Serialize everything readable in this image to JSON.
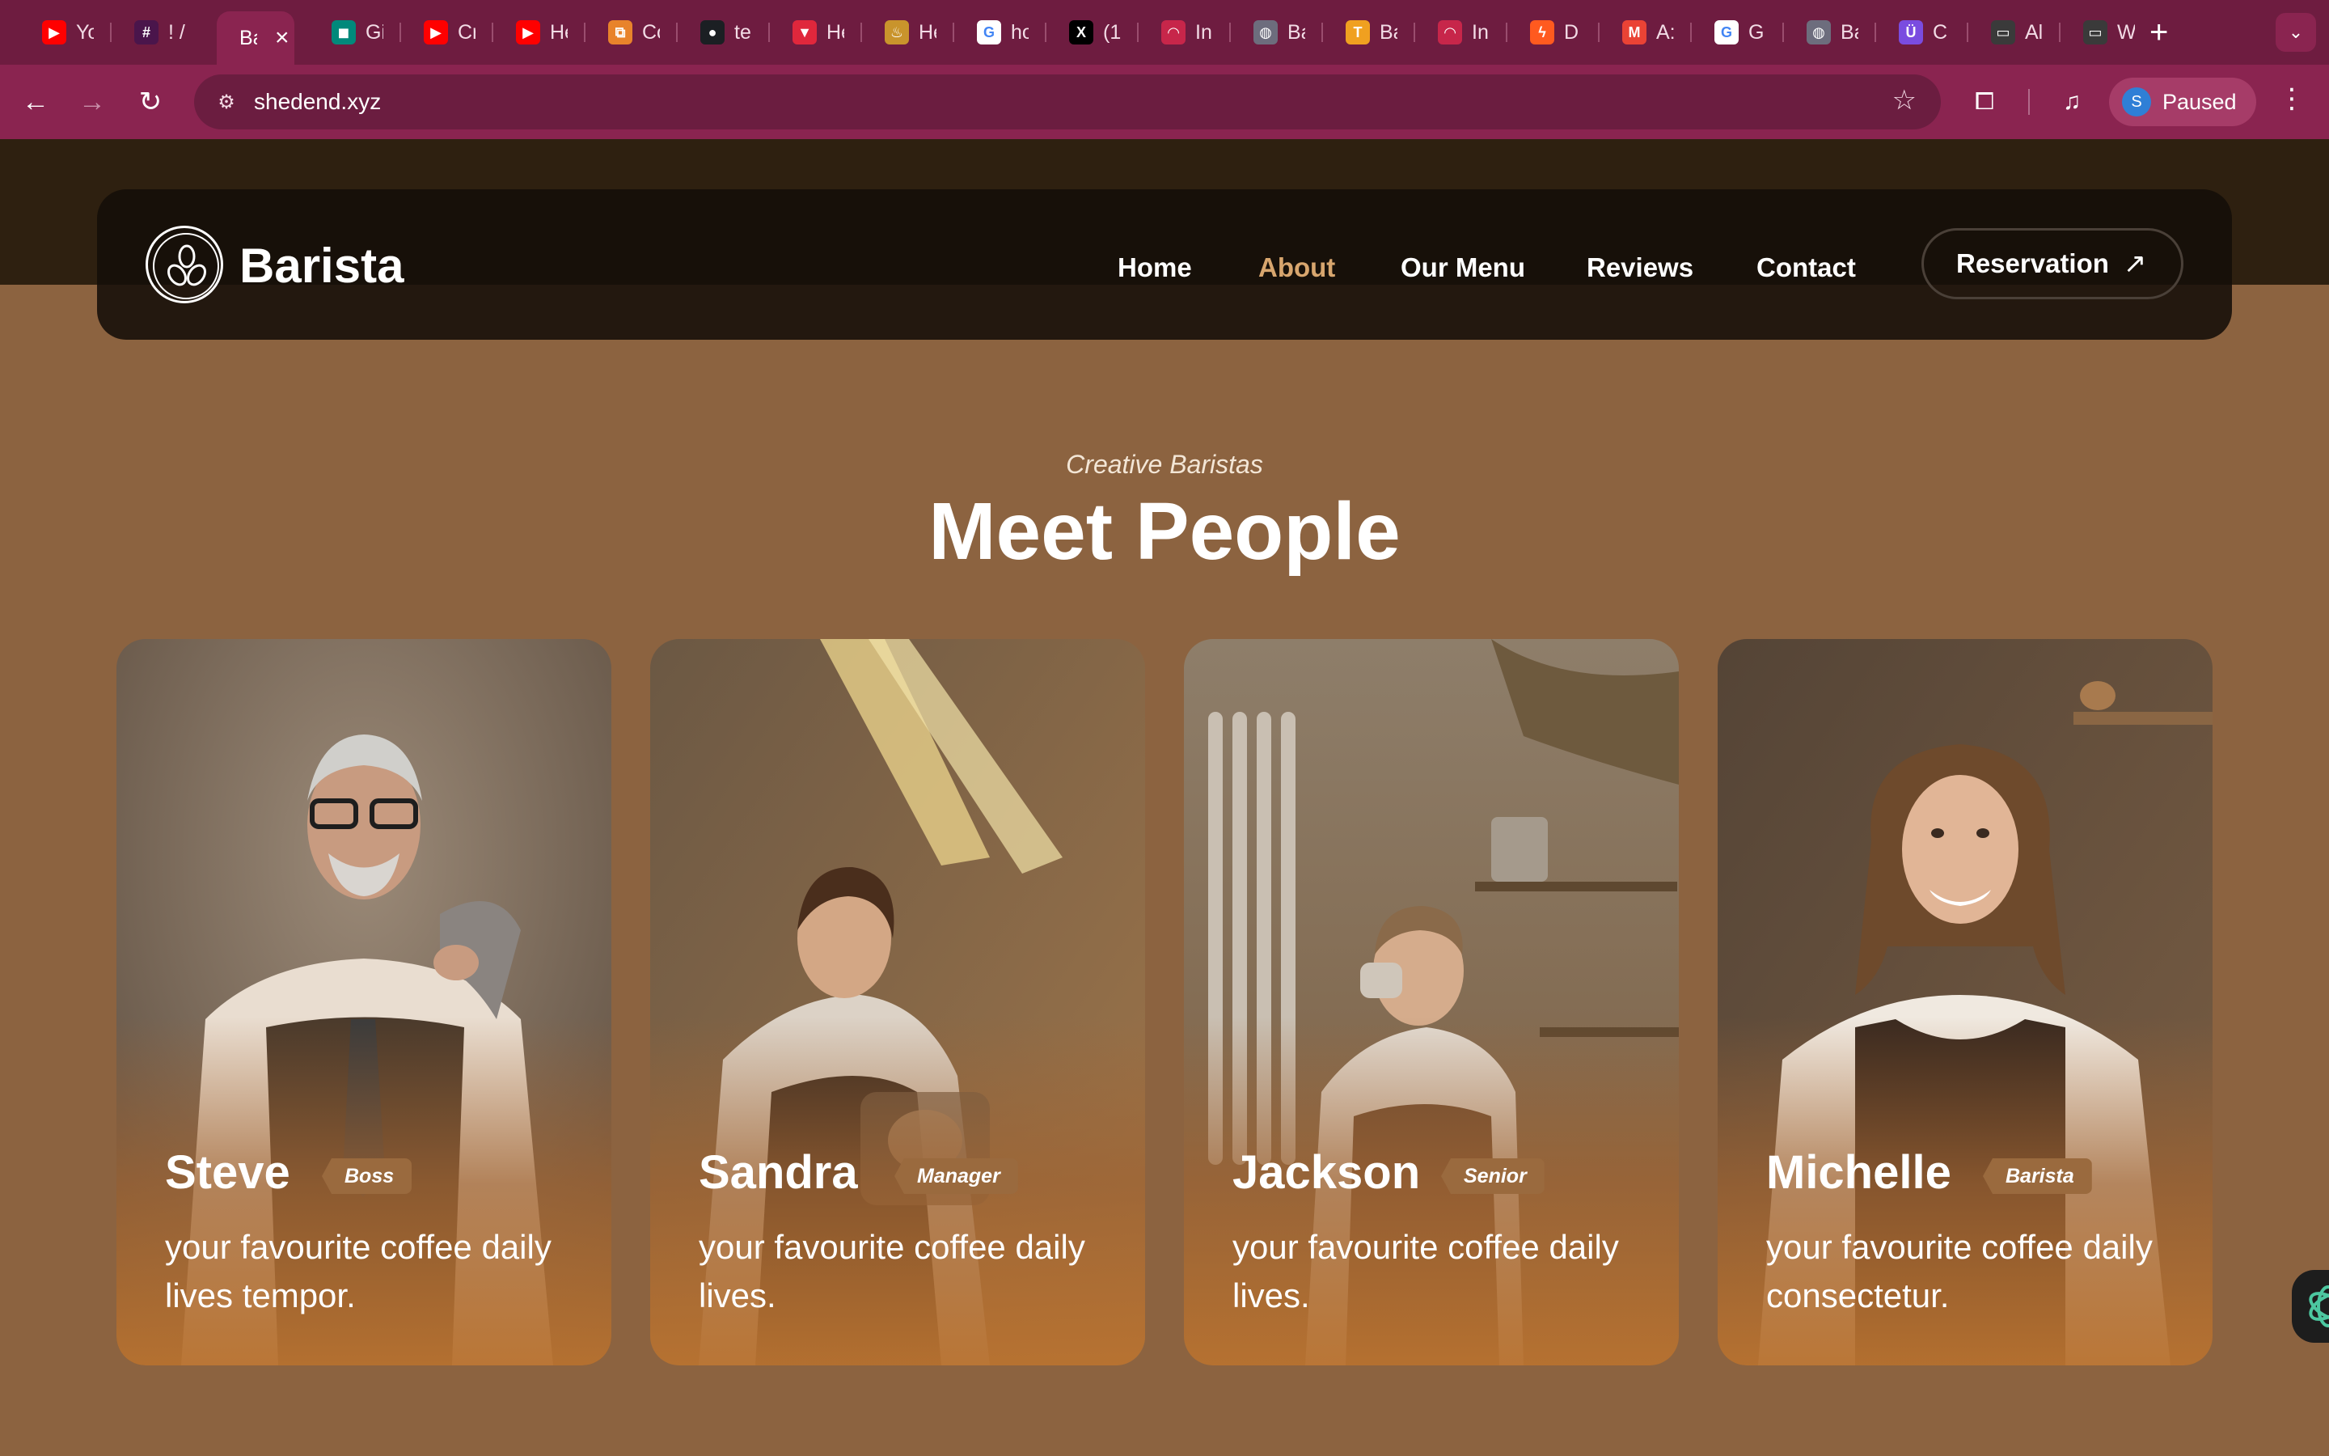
{
  "browser": {
    "tabs": [
      {
        "title": "Yo",
        "icon": "youtube-icon",
        "color": "#ff0000",
        "glyph": "▶"
      },
      {
        "title": "! /",
        "icon": "slack-icon",
        "color": "#4a154b",
        "glyph": "#"
      },
      {
        "title": "Ba",
        "icon": "barista-icon",
        "color": "#8a2450",
        "glyph": "",
        "active": true
      },
      {
        "title": "Gi",
        "icon": "google-meet-icon",
        "color": "#00897b",
        "glyph": "◼"
      },
      {
        "title": "Cr",
        "icon": "youtube-icon",
        "color": "#ff0000",
        "glyph": "▶"
      },
      {
        "title": "He",
        "icon": "youtube-icon",
        "color": "#ff0000",
        "glyph": "▶"
      },
      {
        "title": "Co",
        "icon": "orange-app-icon",
        "color": "#e8832b",
        "glyph": "⧉"
      },
      {
        "title": "te",
        "icon": "github-icon",
        "color": "#1b1f23",
        "glyph": "●"
      },
      {
        "title": "He",
        "icon": "triangle-app-icon",
        "color": "#e0273c",
        "glyph": "▼"
      },
      {
        "title": "He",
        "icon": "beer-icon",
        "color": "#c9942c",
        "glyph": "♨"
      },
      {
        "title": "ho",
        "icon": "google-icon",
        "color": "#ffffff",
        "glyph": "G"
      },
      {
        "title": "(1",
        "icon": "x-icon",
        "color": "#000000",
        "glyph": "X"
      },
      {
        "title": "In",
        "icon": "gauge-icon",
        "color": "#c7264a",
        "glyph": "◠"
      },
      {
        "title": "Ba",
        "icon": "globe-icon",
        "color": "#6d6d7d",
        "glyph": "◍"
      },
      {
        "title": "Ba",
        "icon": "t-icon",
        "color": "#f0a020",
        "glyph": "T"
      },
      {
        "title": "In",
        "icon": "gauge-icon",
        "color": "#c7264a",
        "glyph": "◠"
      },
      {
        "title": "D",
        "icon": "zap-icon",
        "color": "#ff5a1f",
        "glyph": "ϟ"
      },
      {
        "title": "A:",
        "icon": "gmail-icon",
        "color": "#ea4335",
        "glyph": "M"
      },
      {
        "title": "G",
        "icon": "google-icon",
        "color": "#ffffff",
        "glyph": "G"
      },
      {
        "title": "Ba",
        "icon": "globe-icon",
        "color": "#6d6d7d",
        "glyph": "◍"
      },
      {
        "title": "C",
        "icon": "proton-icon",
        "color": "#7a4ce0",
        "glyph": "Ü"
      },
      {
        "title": "Al",
        "icon": "folder-icon",
        "color": "#3a3a3a",
        "glyph": "▭"
      },
      {
        "title": "W",
        "icon": "folder-icon",
        "color": "#3a3a3a",
        "glyph": "▭"
      }
    ],
    "url": "shedend.xyz",
    "profile_initial": "S",
    "profile_label": "Paused"
  },
  "site": {
    "brand": "Barista",
    "nav": [
      {
        "label": "Home",
        "active": false
      },
      {
        "label": "About",
        "active": true
      },
      {
        "label": "Our Menu",
        "active": false
      },
      {
        "label": "Reviews",
        "active": false
      },
      {
        "label": "Contact",
        "active": false
      }
    ],
    "reservation_label": "Reservation",
    "accent": "#d8a66e"
  },
  "team": {
    "eyebrow": "Creative Baristas",
    "title": "Meet People",
    "members": [
      {
        "name": "Steve",
        "role": "Boss",
        "description": "your favourite coffee daily lives tempor."
      },
      {
        "name": "Sandra",
        "role": "Manager",
        "description": "your favourite coffee daily lives."
      },
      {
        "name": "Jackson",
        "role": "Senior",
        "description": "your favourite coffee daily lives."
      },
      {
        "name": "Michelle",
        "role": "Barista",
        "description": "your favourite coffee daily consectetur."
      }
    ]
  }
}
